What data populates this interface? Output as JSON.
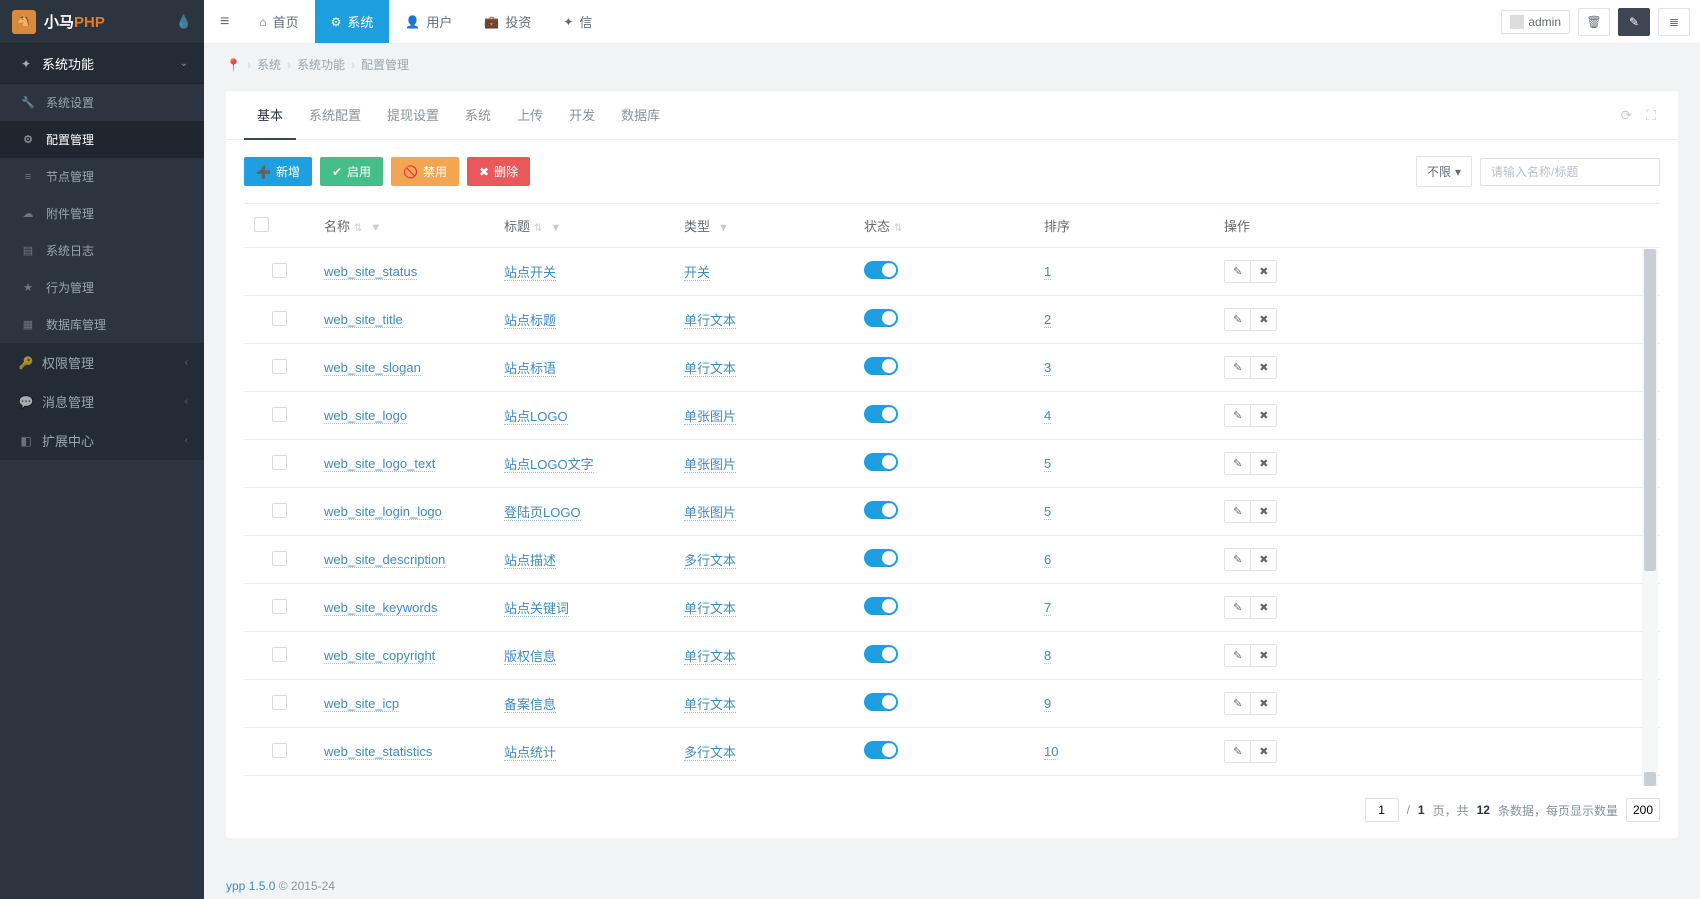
{
  "logo": {
    "prefix": "小马",
    "suffix": "PHP"
  },
  "sidebar": {
    "groups": [
      {
        "label": "系统功能",
        "icon": "✦",
        "expanded": true,
        "items": [
          {
            "label": "系统设置",
            "icon": "🔧",
            "active": false
          },
          {
            "label": "配置管理",
            "icon": "⚙",
            "active": true
          },
          {
            "label": "节点管理",
            "icon": "≡",
            "active": false
          },
          {
            "label": "附件管理",
            "icon": "☁",
            "active": false
          },
          {
            "label": "系统日志",
            "icon": "▤",
            "active": false
          },
          {
            "label": "行为管理",
            "icon": "★",
            "active": false
          },
          {
            "label": "数据库管理",
            "icon": "▦",
            "active": false
          }
        ]
      },
      {
        "label": "权限管理",
        "icon": "🔑",
        "expanded": false,
        "items": []
      },
      {
        "label": "消息管理",
        "icon": "💬",
        "expanded": false,
        "items": []
      },
      {
        "label": "扩展中心",
        "icon": "◧",
        "expanded": false,
        "items": []
      }
    ]
  },
  "topnav": [
    {
      "label": "首页",
      "icon": "⌂",
      "active": false
    },
    {
      "label": "系统",
      "icon": "⚙",
      "active": true
    },
    {
      "label": "用户",
      "icon": "👤",
      "active": false
    },
    {
      "label": "投资",
      "icon": "💼",
      "active": false
    },
    {
      "label": "信",
      "icon": "✦",
      "active": false
    }
  ],
  "admin_label": "admin",
  "breadcrumb": [
    "系统",
    "系统功能",
    "配置管理"
  ],
  "tabs": [
    "基本",
    "系统配置",
    "提现设置",
    "系统",
    "上传",
    "开发",
    "数据库"
  ],
  "active_tab": 0,
  "toolbar": {
    "add": "新增",
    "enable": "启用",
    "disable": "禁用",
    "delete": "删除",
    "filter_label": "不限",
    "search_placeholder": "请输入名称/标题"
  },
  "columns": {
    "name": "名称",
    "title": "标题",
    "type": "类型",
    "status": "状态",
    "sort": "排序",
    "action": "操作"
  },
  "rows": [
    {
      "name": "web_site_status",
      "title": "站点开关",
      "type": "开关",
      "sort": "1"
    },
    {
      "name": "web_site_title",
      "title": "站点标题",
      "type": "单行文本",
      "sort": "2"
    },
    {
      "name": "web_site_slogan",
      "title": "站点标语",
      "type": "单行文本",
      "sort": "3"
    },
    {
      "name": "web_site_logo",
      "title": "站点LOGO",
      "type": "单张图片",
      "sort": "4"
    },
    {
      "name": "web_site_logo_text",
      "title": "站点LOGO文字",
      "type": "单张图片",
      "sort": "5"
    },
    {
      "name": "web_site_login_logo",
      "title": "登陆页LOGO",
      "type": "单张图片",
      "sort": "5"
    },
    {
      "name": "web_site_description",
      "title": "站点描述",
      "type": "多行文本",
      "sort": "6"
    },
    {
      "name": "web_site_keywords",
      "title": "站点关键词",
      "type": "单行文本",
      "sort": "7"
    },
    {
      "name": "web_site_copyright",
      "title": "版权信息",
      "type": "单行文本",
      "sort": "8"
    },
    {
      "name": "web_site_icp",
      "title": "备案信息",
      "type": "单行文本",
      "sort": "9"
    },
    {
      "name": "web_site_statistics",
      "title": "站点统计",
      "type": "多行文本",
      "sort": "10"
    }
  ],
  "pager": {
    "current": "1",
    "total_pages": "1",
    "label_page": "页，共",
    "total_count": "12",
    "label_count": "条数据，每页显示数量",
    "per_page": "200",
    "sep": "/"
  },
  "footer": {
    "version_prefix": "ypp",
    "version": "1.5.0",
    "copyright": "© 2015-24"
  }
}
